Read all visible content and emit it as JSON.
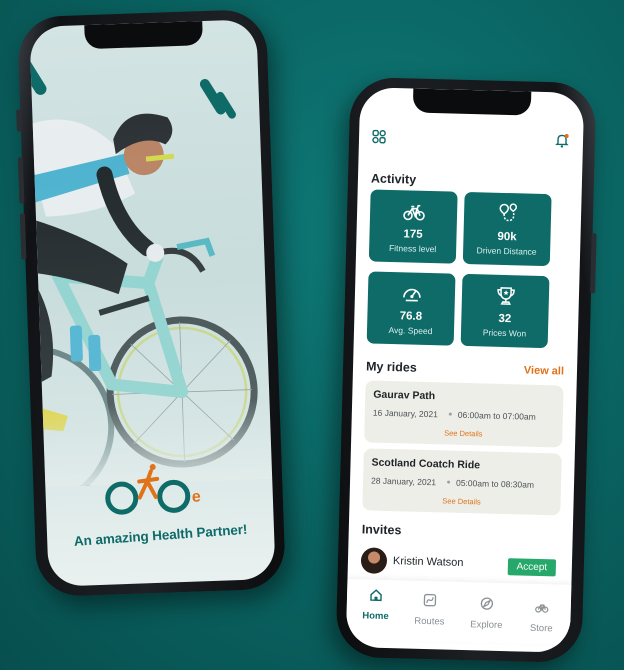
{
  "splash": {
    "tagline": "An amazing Health Partner!",
    "logo_letter": "e"
  },
  "home": {
    "activity_title": "Activity",
    "stats": [
      {
        "icon": "bicycle-icon",
        "value": "175",
        "label": "Fitness level"
      },
      {
        "icon": "route-pin-icon",
        "value": "90k",
        "label": "Driven Distance"
      },
      {
        "icon": "speedometer-icon",
        "value": "76.8",
        "label": "Avg. Speed"
      },
      {
        "icon": "trophy-icon",
        "value": "32",
        "label": "Prices Won"
      }
    ],
    "rides_title": "My rides",
    "view_all": "View all",
    "rides": [
      {
        "name": "Gaurav Path",
        "date": "16 January, 2021",
        "time": "06:00am to 07:00am",
        "details": "See Details"
      },
      {
        "name": "Scotland Coatch Ride",
        "date": "28 January, 2021",
        "time": "05:00am to 08:30am",
        "details": "See Details"
      }
    ],
    "invites_title": "Invites",
    "invite": {
      "name": "Kristin Watson",
      "action": "Accept"
    },
    "nav": [
      {
        "label": "Home",
        "icon": "home-icon",
        "active": true
      },
      {
        "label": "Routes",
        "icon": "routes-icon",
        "active": false
      },
      {
        "label": "Explore",
        "icon": "explore-icon",
        "active": false
      },
      {
        "label": "Store",
        "icon": "store-icon",
        "active": false
      }
    ]
  },
  "colors": {
    "brand_teal": "#0e6b68",
    "accent_orange": "#e0731a",
    "accept_green": "#25a86a"
  }
}
